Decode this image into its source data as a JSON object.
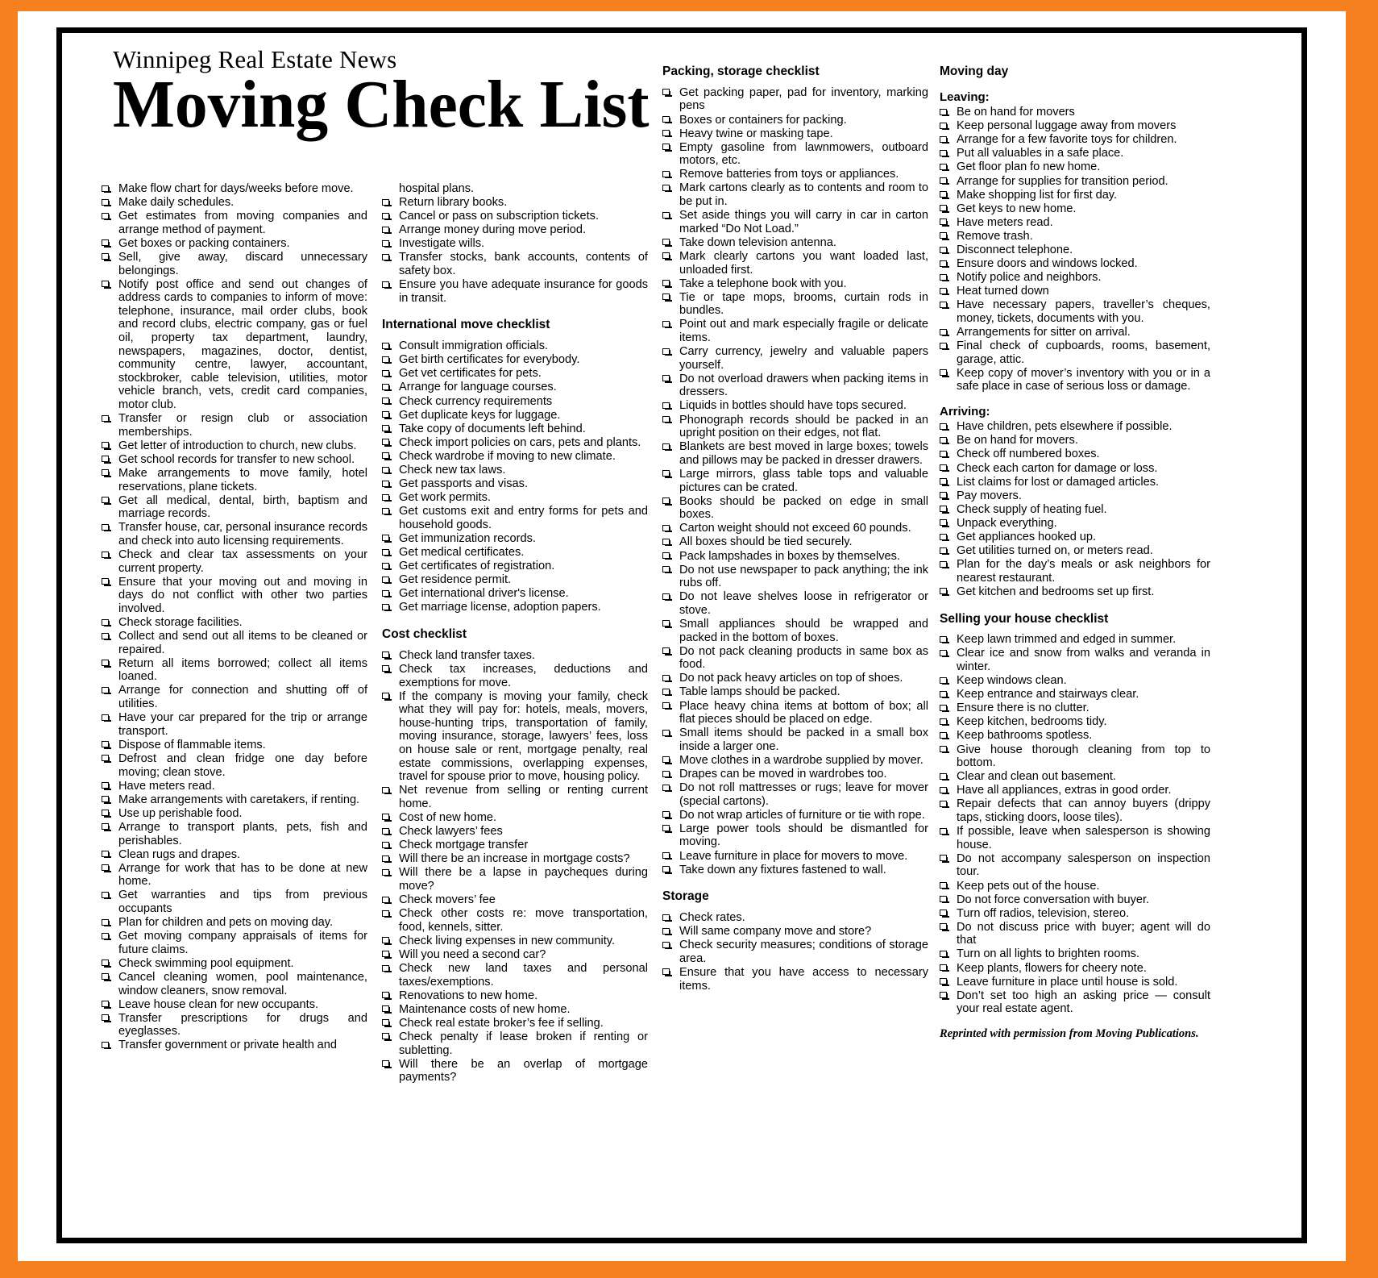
{
  "masthead": {
    "kicker": "Winnipeg Real Estate News",
    "headline": "Moving Check List"
  },
  "credit": "Reprinted with permission from Moving Publications.",
  "columns": {
    "col1": {
      "items": [
        "Make flow chart for days/weeks before move.",
        "Make daily schedules.",
        "Get estimates from moving companies and arrange method of payment.",
        "Get boxes or packing containers.",
        "Sell, give away, discard unnecessary belongings.",
        "Notify post office and send out changes of address cards to companies to inform of move: telephone, insurance, mail order clubs, book and record clubs, electric company, gas or fuel oil, property tax department, laundry, newspapers, magazines, doctor, dentist, community centre, lawyer, accountant, stockbroker, cable television, utilities, motor vehicle branch, vets, credit card companies, motor club.",
        "Transfer or resign club or association memberships.",
        "Get letter of introduction to church, new clubs.",
        "Get school records for transfer to new school.",
        "Make arrangements to move family, hotel reservations, plane tickets.",
        "Get all medical, dental, birth, baptism and marriage records.",
        "Transfer house, car, personal insurance records and check into auto licensing requirements.",
        "Check and clear tax assessments on your current property.",
        "Ensure that your moving out and moving in days do not conflict with other two parties involved.",
        "Check storage facilities.",
        "Collect and send out all items to be cleaned or repaired.",
        "Return all items borrowed; collect all items loaned.",
        "Arrange for connection and shutting off of utilities.",
        "Have your car prepared for the trip or arrange transport.",
        "Dispose of flammable items.",
        "Defrost and clean fridge one day before moving; clean stove.",
        "Have meters read.",
        "Make arrangements with caretakers, if renting.",
        "Use up perishable food.",
        "Arrange to transport plants, pets, fish and perishables.",
        "Clean rugs and drapes.",
        "Arrange for work that has to be done at new home.",
        "Get warranties and tips from previous occupants",
        "Plan for children and pets on moving day.",
        "Get moving company appraisals of items for future claims.",
        "Check swimming pool equipment.",
        "Cancel cleaning women, pool maintenance, window cleaners, snow removal.",
        "Leave house clean for new occupants.",
        "Transfer prescriptions for drugs and eyeglasses.",
        "Transfer government or private health and"
      ]
    },
    "col2": {
      "continuation": "hospital plans.",
      "items_top": [
        "Return library books.",
        "Cancel or pass on subscription tickets.",
        "Arrange money during move period.",
        "Investigate wills.",
        "Transfer stocks, bank accounts, contents of safety box.",
        "Ensure you have adequate insurance for goods in transit."
      ],
      "international_heading": "International move checklist",
      "international_items": [
        "Consult immigration officials.",
        "Get birth certificates for everybody.",
        "Get vet certificates for pets.",
        "Arrange for language courses.",
        "Check currency requirements",
        "Get duplicate keys for luggage.",
        "Take copy of documents left behind.",
        "Check import policies on cars, pets and plants.",
        "Check wardrobe if moving to new climate.",
        "Check new tax laws.",
        "Get passports and visas.",
        "Get work permits.",
        "Get customs exit and entry forms for pets and household goods.",
        "Get immunization records.",
        "Get medical certificates.",
        "Get certificates of registration.",
        "Get residence permit.",
        "Get international driver's license.",
        "Get marriage license, adoption papers."
      ],
      "cost_heading": "Cost checklist",
      "cost_items": [
        "Check land transfer taxes.",
        "Check tax increases, deductions and exemptions for move.",
        "If the company is moving your family, check what they will pay for: hotels, meals, movers, house-hunting trips, transportation of family, moving insurance, storage, lawyers’ fees, loss on house sale or rent, mortgage penalty, real estate commissions, overlapping expenses, travel for spouse prior to move, housing policy.",
        "Net revenue from selling or renting current home.",
        "Cost of new home.",
        "Check lawyers’ fees",
        "Check mortgage transfer",
        "Will there be an increase in mortgage costs?",
        "Will there be a lapse in paycheques during move?",
        "Check movers’ fee",
        "Check other costs re: move transportation, food, kennels, sitter.",
        "Check living expenses in new community.",
        "Will you need a second car?",
        "Check new land taxes and personal taxes/exemptions.",
        "Renovations to new home.",
        "Maintenance costs of new home.",
        "Check real estate broker’s fee if selling.",
        "Check penalty if lease broken if renting or subletting.",
        "Will there be an overlap of mortgage payments?"
      ]
    },
    "col3": {
      "packing_heading": "Packing, storage checklist",
      "packing_items": [
        "Get packing paper, pad for inventory, marking pens",
        "Boxes or containers for packing.",
        "Heavy twine or masking tape.",
        "Empty gasoline from lawnmowers, outboard motors, etc.",
        "Remove batteries from toys or appliances.",
        "Mark cartons clearly as to contents and room to be put in.",
        "Set aside things you will carry in car in carton marked “Do Not Load.”",
        "Take down television antenna.",
        "Mark clearly cartons you want loaded last, unloaded first.",
        "Take a telephone book with you.",
        "Tie or tape mops, brooms, curtain rods in bundles.",
        "Point out and mark especially fragile or delicate items.",
        "Carry currency, jewelry and valuable papers yourself.",
        "Do not overload drawers when packing items in dressers.",
        "Liquids in bottles should have tops secured.",
        "Phonograph records should be packed in an upright position on their edges, not flat.",
        "Blankets are best moved in large boxes; towels and pillows may be packed in dresser drawers.",
        "Large mirrors, glass table tops and valuable pictures can be crated.",
        "Books should be packed on edge in small boxes.",
        "Carton weight should not exceed 60 pounds.",
        "All boxes should be tied securely.",
        "Pack lampshades in boxes by themselves.",
        "Do not use newspaper to pack anything; the ink rubs off.",
        "Do not leave shelves loose in refrigerator or stove.",
        "Small appliances should be wrapped and packed in the bottom of boxes.",
        "Do not pack cleaning products in same box as food.",
        "Do not pack heavy articles on top of shoes.",
        "Table lamps should be packed.",
        "Place heavy china items at bottom of box; all flat pieces should be placed on edge.",
        "Small items should be packed in a small box inside a larger one.",
        "Move clothes in a wardrobe supplied by mover.",
        "Drapes can be moved in wardrobes too.",
        "Do not roll mattresses or rugs; leave for mover (special cartons).",
        "Do not wrap articles of furniture or tie with rope.",
        "Large power tools should be dismantled for moving.",
        "Leave furniture in place for movers to move.",
        "Take down any fixtures fastened to wall."
      ],
      "storage_heading": "Storage",
      "storage_items": [
        "Check rates.",
        "Will same company move and store?",
        "Check security measures; conditions of storage area.",
        "Ensure that you have access to necessary items."
      ]
    },
    "col4": {
      "moving_day_heading": "Moving day",
      "leaving_heading": "Leaving:",
      "leaving_items": [
        "Be on hand for movers",
        "Keep personal luggage away from movers",
        "Arrange for a few favorite toys for children.",
        "Put all valuables in a safe place.",
        "Get floor plan fo new home.",
        "Arrange for supplies for transition period.",
        "Make shopping list for first day.",
        "Get keys to new home.",
        "Have meters read.",
        "Remove trash.",
        "Disconnect telephone.",
        "Ensure doors and windows locked.",
        "Notify police and neighbors.",
        "Heat turned down",
        "Have necessary papers, traveller’s cheques, money, tickets, documents with you.",
        "Arrangements for sitter on arrival.",
        "Final check of cupboards, rooms, basement, garage, attic.",
        "Keep copy of mover’s inventory with you or in a safe place in case of serious loss or damage."
      ],
      "arriving_heading": "Arriving:",
      "arriving_items": [
        "Have children, pets elsewhere if possible.",
        "Be on hand for movers.",
        "Check off numbered boxes.",
        "Check each carton for damage or loss.",
        "List claims for lost or damaged articles.",
        "Pay movers.",
        "Check supply of heating fuel.",
        "Unpack everything.",
        "Get appliances hooked up.",
        "Get utilities turned on, or meters read.",
        "Plan for the day’s meals or ask neighbors for nearest restaurant.",
        "Get kitchen and bedrooms set up first."
      ],
      "selling_heading": "Selling your house checklist",
      "selling_items": [
        "Keep lawn trimmed and edged in summer.",
        "Clear ice and snow from walks and veranda in winter.",
        "Keep windows clean.",
        "Keep entrance and stairways clear.",
        "Ensure there is no clutter.",
        "Keep kitchen, bedrooms tidy.",
        "Keep bathrooms spotless.",
        "Give house thorough cleaning from top to bottom.",
        "Clear and clean out basement.",
        "Have all appliances, extras in good order.",
        "Repair defects that can annoy buyers (drippy taps, sticking doors, loose tiles).",
        "If possible, leave when salesperson is showing house.",
        "Do not accompany salesperson on inspection tour.",
        "Keep pets out of the house.",
        "Do not force conversation with buyer.",
        "Turn off radios, television, stereo.",
        "Do not discuss price with buyer; agent will do that",
        "Turn on all lights to brighten rooms.",
        "Keep plants, flowers for cheery note.",
        "Leave furniture in place until house is sold.",
        "Don’t set too high an asking price — consult your real estate agent."
      ]
    }
  }
}
